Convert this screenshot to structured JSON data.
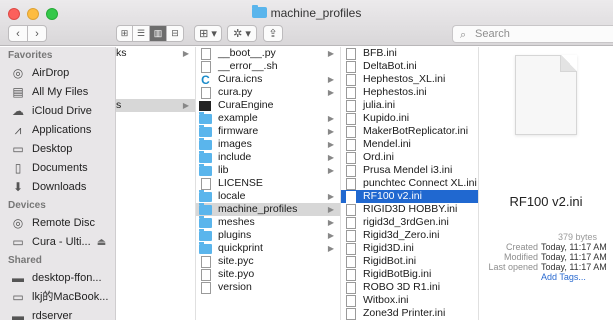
{
  "window": {
    "title": "machine_profiles"
  },
  "toolbar": {
    "back": "‹",
    "forward": "›",
    "view_icons": [
      "⊞",
      "☰",
      "▥",
      "⊟"
    ],
    "arrange": "⊞ ▾",
    "action": "✲ ▾",
    "share": "⇪",
    "search_placeholder": "Search"
  },
  "sidebar": {
    "favorites_header": "Favorites",
    "favorites": [
      {
        "icon": "airdrop-icon",
        "glyph": "◎",
        "label": "AirDrop"
      },
      {
        "icon": "all-files-icon",
        "glyph": "▤",
        "label": "All My Files"
      },
      {
        "icon": "icloud-icon",
        "glyph": "☁",
        "label": "iCloud Drive"
      },
      {
        "icon": "applications-icon",
        "glyph": "⩘",
        "label": "Applications"
      },
      {
        "icon": "desktop-icon",
        "glyph": "▭",
        "label": "Desktop"
      },
      {
        "icon": "documents-icon",
        "glyph": "▯",
        "label": "Documents"
      },
      {
        "icon": "downloads-icon",
        "glyph": "⬇",
        "label": "Downloads"
      }
    ],
    "devices_header": "Devices",
    "devices": [
      {
        "icon": "remote-disc-icon",
        "glyph": "◎",
        "label": "Remote Disc"
      },
      {
        "icon": "drive-icon",
        "glyph": "▭",
        "label": "Cura - Ulti..."
      }
    ],
    "shared_header": "Shared",
    "shared": [
      {
        "icon": "computer-icon",
        "glyph": "▬",
        "label": "desktop-ffon..."
      },
      {
        "icon": "laptop-icon",
        "glyph": "▭",
        "label": "lkj的MacBook..."
      },
      {
        "icon": "server-icon",
        "glyph": "▬",
        "label": "rdserver"
      }
    ]
  },
  "column1": [
    "ks",
    "",
    "",
    "",
    "s"
  ],
  "column2": [
    {
      "type": "py",
      "label": "__boot__.py",
      "chev": "▶"
    },
    {
      "type": "doc",
      "label": "__error__.sh",
      "chev": ""
    },
    {
      "type": "cura",
      "label": "Cura.icns",
      "chev": "▶"
    },
    {
      "type": "py",
      "label": "cura.py",
      "chev": "▶"
    },
    {
      "type": "exec",
      "label": "CuraEngine",
      "chev": ""
    },
    {
      "type": "folder",
      "label": "example",
      "chev": "▶"
    },
    {
      "type": "folder",
      "label": "firmware",
      "chev": "▶"
    },
    {
      "type": "folder",
      "label": "images",
      "chev": "▶"
    },
    {
      "type": "folder",
      "label": "include",
      "chev": "▶"
    },
    {
      "type": "folder",
      "label": "lib",
      "chev": "▶"
    },
    {
      "type": "doc",
      "label": "LICENSE",
      "chev": ""
    },
    {
      "type": "folder",
      "label": "locale",
      "chev": "▶"
    },
    {
      "type": "folder",
      "label": "machine_profiles",
      "chev": "▶",
      "hl": true
    },
    {
      "type": "folder",
      "label": "meshes",
      "chev": "▶"
    },
    {
      "type": "folder",
      "label": "plugins",
      "chev": "▶"
    },
    {
      "type": "folder",
      "label": "quickprint",
      "chev": "▶"
    },
    {
      "type": "doc",
      "label": "site.pyc",
      "chev": ""
    },
    {
      "type": "doc",
      "label": "site.pyo",
      "chev": ""
    },
    {
      "type": "doc",
      "label": "version",
      "chev": ""
    }
  ],
  "column3": [
    "BFB.ini",
    "DeltaBot.ini",
    "Hephestos_XL.ini",
    "Hephestos.ini",
    "julia.ini",
    "Kupido.ini",
    "MakerBotReplicator.ini",
    "Mendel.ini",
    "Ord.ini",
    "Prusa Mendel i3.ini",
    "punchtec Connect XL.ini",
    "RF100 v2.ini",
    "RIGID3D HOBBY.ini",
    "rigid3d_3rdGen.ini",
    "Rigid3d_Zero.ini",
    "Rigid3D.ini",
    "RigidBot.ini",
    "RigidBotBig.ini",
    "ROBO 3D R1.ini",
    "Witbox.ini",
    "Zone3d Printer.ini"
  ],
  "selected_index": 11,
  "preview": {
    "name": "RF100 v2.ini",
    "size": "379 bytes",
    "created_label": "Created",
    "created": "Today, 11:17 AM",
    "modified_label": "Modified",
    "modified": "Today, 11:17 AM",
    "opened_label": "Last opened",
    "opened": "Today, 11:17 AM",
    "add_tags": "Add Tags..."
  },
  "colors": {
    "selection": "#2068d0",
    "folder": "#5ab5ec",
    "sidebar": "#e8e6e8"
  }
}
